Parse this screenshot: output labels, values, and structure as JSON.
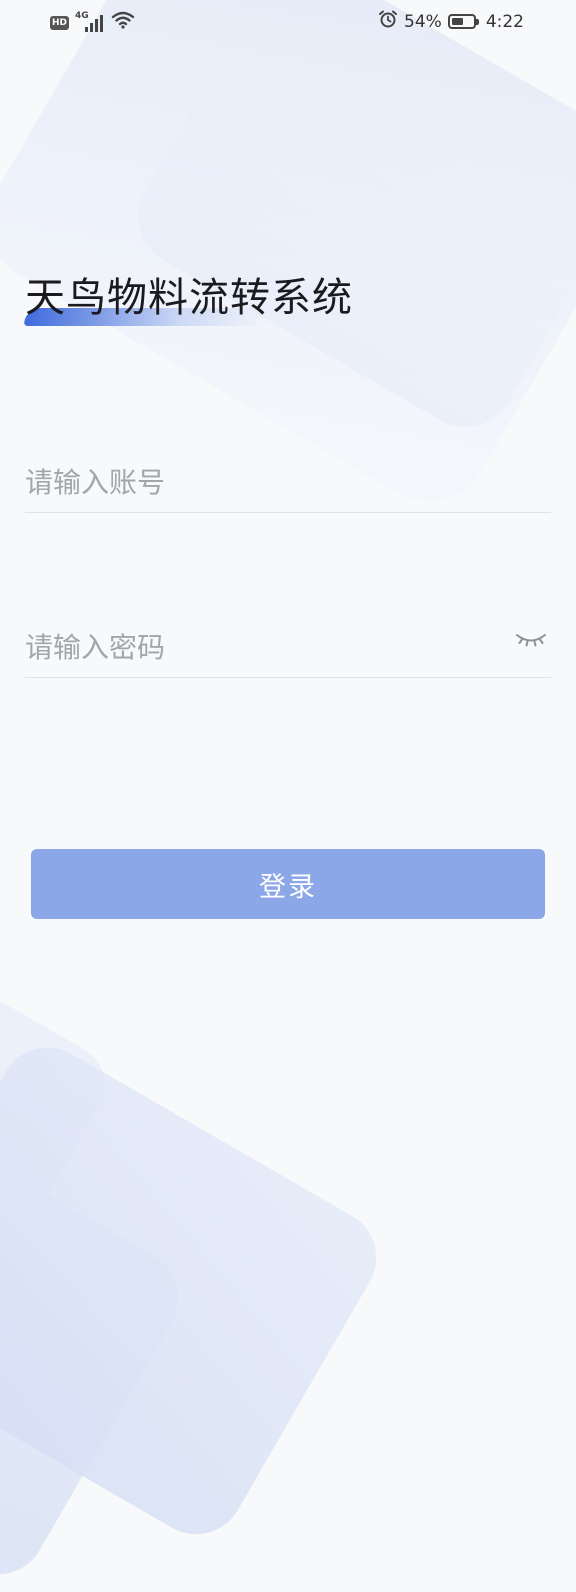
{
  "status_bar": {
    "hd_badge": "HD",
    "network_type": "4G",
    "battery_percent_text": "54%",
    "battery_level": 0.54,
    "time": "4:22",
    "icons": [
      "signal-icon",
      "wifi-icon",
      "alarm-icon",
      "battery-icon"
    ]
  },
  "login": {
    "title": "天鸟物料流转系统",
    "account_placeholder": "请输入账号",
    "account_value": "",
    "password_placeholder": "请输入密码",
    "password_value": "",
    "password_toggle_icon": "eye-closed-icon",
    "submit_label": "登录"
  },
  "colors": {
    "accent": "#3f6bdc",
    "button_bg": "#8ba7e8",
    "placeholder": "#a2a5ab",
    "background": "#f8f9fb"
  }
}
